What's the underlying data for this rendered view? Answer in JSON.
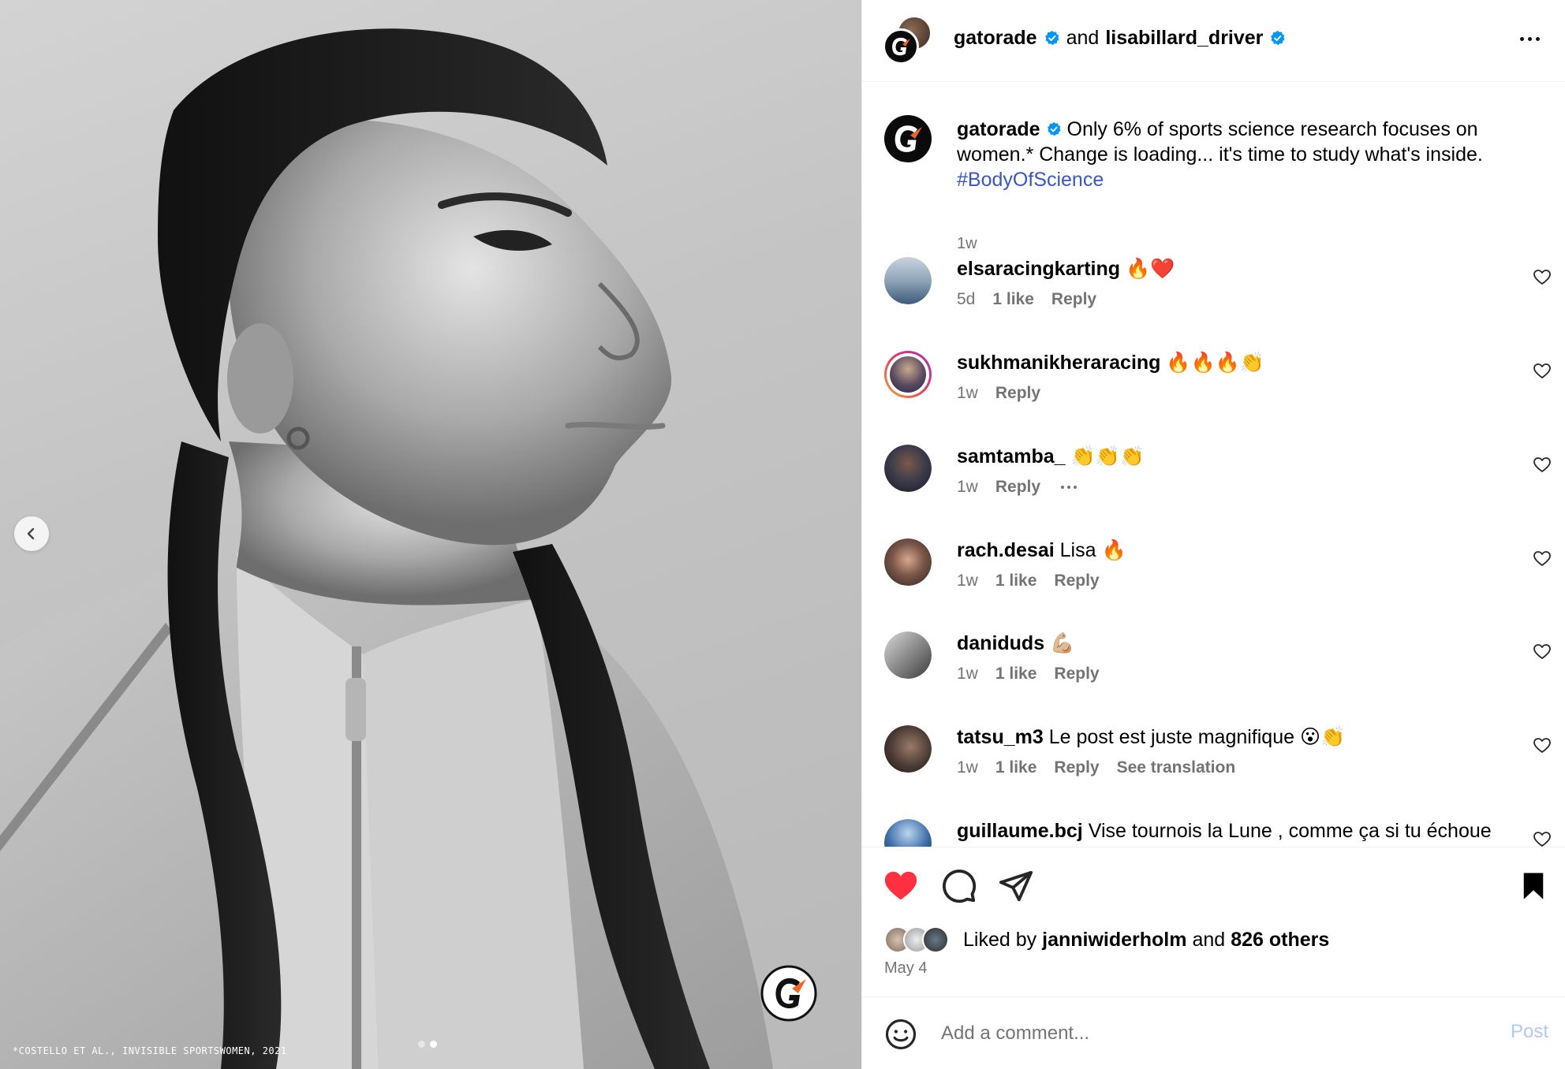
{
  "media": {
    "footnote": "*COSTELLO ET AL., INVISIBLE SPORTSWOMEN, 2021",
    "slide_count": 2,
    "active_slide": 2
  },
  "header": {
    "user1": "gatorade",
    "conjunction": "and",
    "user2": "lisabillard_driver"
  },
  "caption": {
    "user": "gatorade",
    "text": "Only 6% of sports science research focuses on women.* Change is loading... it's time to study what's inside.",
    "hashtag": "#BodyOfScience",
    "time": "1w"
  },
  "comments": [
    {
      "user": "elsaracingkarting",
      "text": "🔥❤️",
      "time": "5d",
      "likes": "1 like",
      "reply": "Reply",
      "extra": ""
    },
    {
      "user": "sukhmanikheraracing",
      "text": "🔥🔥🔥👏",
      "time": "1w",
      "likes": "",
      "reply": "Reply",
      "extra": ""
    },
    {
      "user": "samtamba_",
      "text": "👏👏👏",
      "time": "1w",
      "likes": "",
      "reply": "Reply",
      "extra": ""
    },
    {
      "user": "rach.desai",
      "text": "Lisa 🔥",
      "time": "1w",
      "likes": "1 like",
      "reply": "Reply",
      "extra": ""
    },
    {
      "user": "daniduds",
      "text": "💪🏼",
      "time": "1w",
      "likes": "1 like",
      "reply": "Reply",
      "extra": ""
    },
    {
      "user": "tatsu_m3",
      "text": "Le post est juste magnifique 😮👏",
      "time": "1w",
      "likes": "1 like",
      "reply": "Reply",
      "extra": "See translation"
    },
    {
      "user": "guillaume.bcj",
      "text": "Vise tournois la Lune , comme ça si tu échoue",
      "time": "",
      "likes": "",
      "reply": "",
      "extra": ""
    }
  ],
  "likes": {
    "prefix": "Liked by",
    "user": "janniwiderholm",
    "conjunction": "and",
    "others": "826 others",
    "date": "May 4"
  },
  "add_comment": {
    "placeholder": "Add a comment...",
    "post_label": "Post"
  },
  "colors": {
    "heart_red": "#ff3040",
    "verified_blue": "#0095f6",
    "hashtag_blue": "#3a56c6",
    "muted_gray": "#737373",
    "post_disabled": "#b2c9f5",
    "gatorade_orange": "#f26522"
  }
}
